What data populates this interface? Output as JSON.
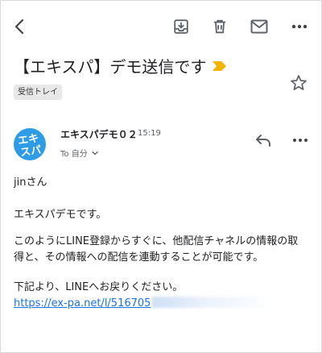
{
  "toolbar": {
    "back_icon": "chevron-left-icon",
    "archive_icon": "archive-icon",
    "delete_icon": "trash-icon",
    "mark_unread_icon": "mail-icon",
    "more_icon": "more-horizontal-icon"
  },
  "email": {
    "subject": "【エキスパ】デモ送信です",
    "label": "受信トレイ",
    "importance_color": "#f4b400",
    "sender": {
      "name": "エキスパデモ０２",
      "time": "15:19",
      "to": "To 自分",
      "avatar_text_line1": "エキ",
      "avatar_text_line2": "スパ",
      "avatar_color": "#2e9be6"
    },
    "body": {
      "greeting": "jinさん",
      "line1": "エキスパデモです。",
      "para2_line1": "このようにLINE登録からすぐに、他配信チャネルの情報の取",
      "para2_line2": "得と、その情報への配信を連動することが可能です。",
      "para3_line1": "下記より、LINEへお戻りください。",
      "link": "https://ex-pa.net/l/516705"
    }
  },
  "colors": {
    "link": "#1a73e8",
    "icon": "#5f6368"
  }
}
